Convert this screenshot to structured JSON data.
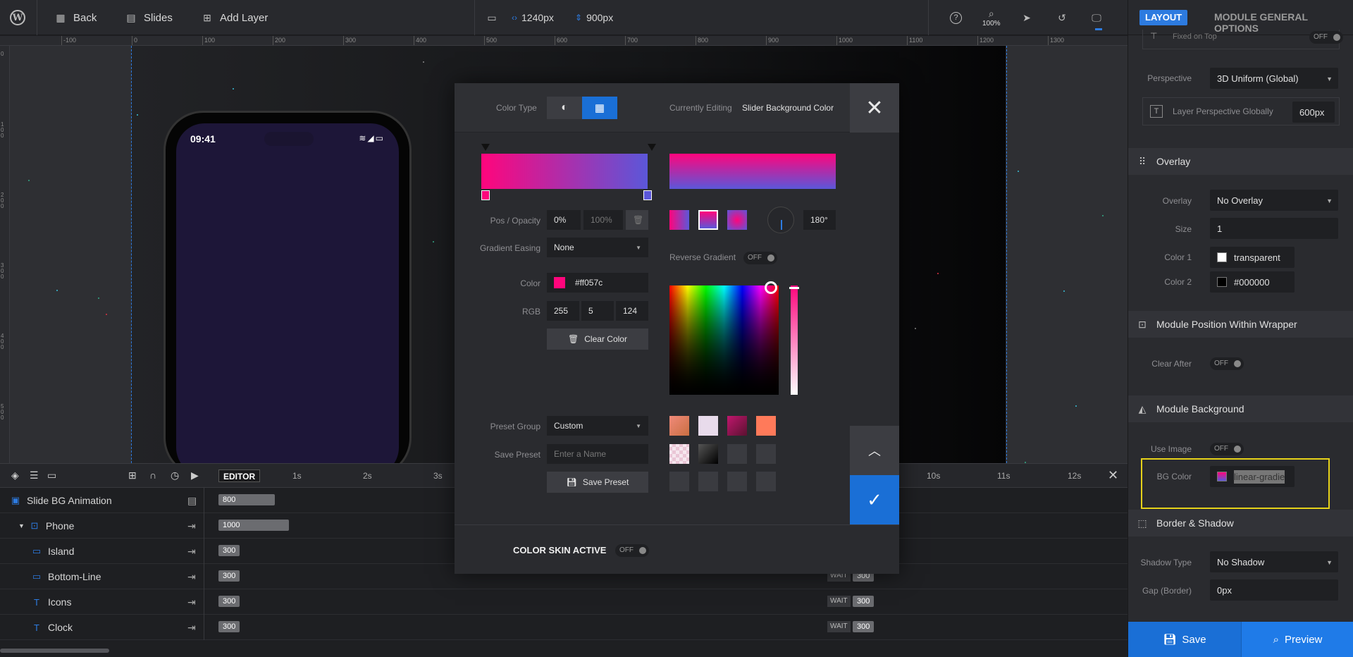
{
  "topbar": {
    "back_label": "Back",
    "slides_label": "Slides",
    "add_layer_label": "Add Layer",
    "width_value": "1240px",
    "height_value": "900px",
    "zoom_label": "100%"
  },
  "ruler": {
    "top_ticks": [
      "-100",
      "0",
      "100",
      "200",
      "300",
      "400",
      "500",
      "600",
      "700",
      "800",
      "900",
      "1000",
      "1100",
      "1200",
      "1300"
    ],
    "left_ticks": [
      "0",
      "100",
      "200",
      "300",
      "400",
      "500"
    ]
  },
  "phone": {
    "time": "09:41"
  },
  "timeline": {
    "editor_label": "EDITOR",
    "seconds": [
      "1s",
      "2s",
      "3s",
      "10s",
      "11s",
      "12s"
    ],
    "rows": [
      {
        "name": "Slide BG Animation",
        "bar": "800"
      },
      {
        "name": "Phone",
        "bar": "1000"
      },
      {
        "name": "Island",
        "bar": "300"
      },
      {
        "name": "Bottom-Line",
        "bar": "300",
        "wait": "WAIT",
        "wait_value": "300"
      },
      {
        "name": "Icons",
        "bar": "300",
        "wait": "WAIT",
        "wait_value": "300"
      },
      {
        "name": "Clock",
        "bar": "300",
        "wait": "WAIT",
        "wait_value": "300"
      }
    ]
  },
  "panel": {
    "layout_badge": "LAYOUT",
    "title": "MODULE GENERAL OPTIONS",
    "fixed_on_top_label": "Fixed on Top",
    "fixed_on_top_state": "OFF",
    "perspective_label": "Perspective",
    "perspective_value": "3D Uniform (Global)",
    "layer_perspective_label": "Layer Perspective Globally",
    "layer_perspective_value": "600px",
    "overlay_section": "Overlay",
    "overlay_label": "Overlay",
    "overlay_value": "No Overlay",
    "size_label": "Size",
    "size_value": "1",
    "color1_label": "Color 1",
    "color1_value": "transparent",
    "color2_label": "Color 2",
    "color2_value": "#000000",
    "position_section": "Module Position Within Wrapper",
    "clear_after_label": "Clear After",
    "clear_after_state": "OFF",
    "background_section": "Module Background",
    "use_image_label": "Use Image",
    "use_image_state": "OFF",
    "bg_color_label": "BG Color",
    "bg_color_value": "linear-gradie",
    "border_section": "Border & Shadow",
    "shadow_type_label": "Shadow Type",
    "shadow_type_value": "No Shadow",
    "gap_label": "Gap (Border)",
    "gap_value": "0px",
    "save_label": "Save",
    "preview_label": "Preview"
  },
  "modal": {
    "color_type_label": "Color Type",
    "currently_editing_label": "Currently Editing",
    "currently_editing_value": "Slider Background Color",
    "pos_opacity_label": "Pos / Opacity",
    "pos_value": "0%",
    "opacity_value": "100%",
    "gradient_easing_label": "Gradient Easing",
    "gradient_easing_value": "None",
    "reverse_gradient_label": "Reverse Gradient",
    "reverse_gradient_state": "OFF",
    "angle_value": "180°",
    "color_label": "Color",
    "color_hex": "#ff057c",
    "rgb_label": "RGB",
    "r": "255",
    "g": "5",
    "b": "124",
    "clear_color_label": "Clear Color",
    "preset_group_label": "Preset Group",
    "preset_group_value": "Custom",
    "save_preset_label": "Save Preset",
    "preset_name_placeholder": "Enter a Name",
    "save_preset_button": "Save Preset",
    "color_skin_label": "COLOR SKIN ACTIVE",
    "color_skin_state": "OFF"
  },
  "colors": {
    "accent": "#2d7be0",
    "gradient_start": "#ff057c",
    "gradient_end": "#5b57d9",
    "phone_screen": "#1d1638",
    "highlight": "#e6d219"
  }
}
